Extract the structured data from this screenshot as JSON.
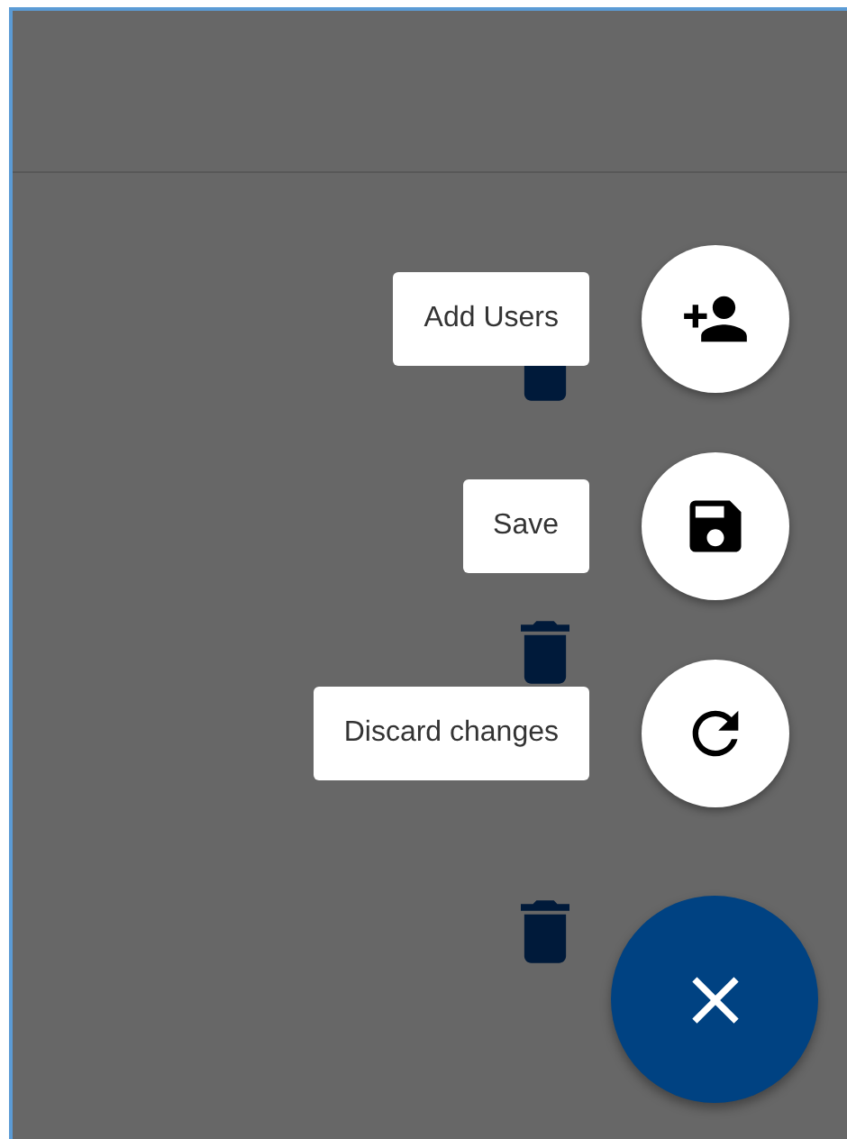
{
  "speed_dial": {
    "open": true,
    "actions": [
      {
        "kind": "add-user",
        "label": "Add Users"
      },
      {
        "kind": "save",
        "label": "Save"
      },
      {
        "kind": "refresh",
        "label": "Discard changes"
      }
    ]
  }
}
